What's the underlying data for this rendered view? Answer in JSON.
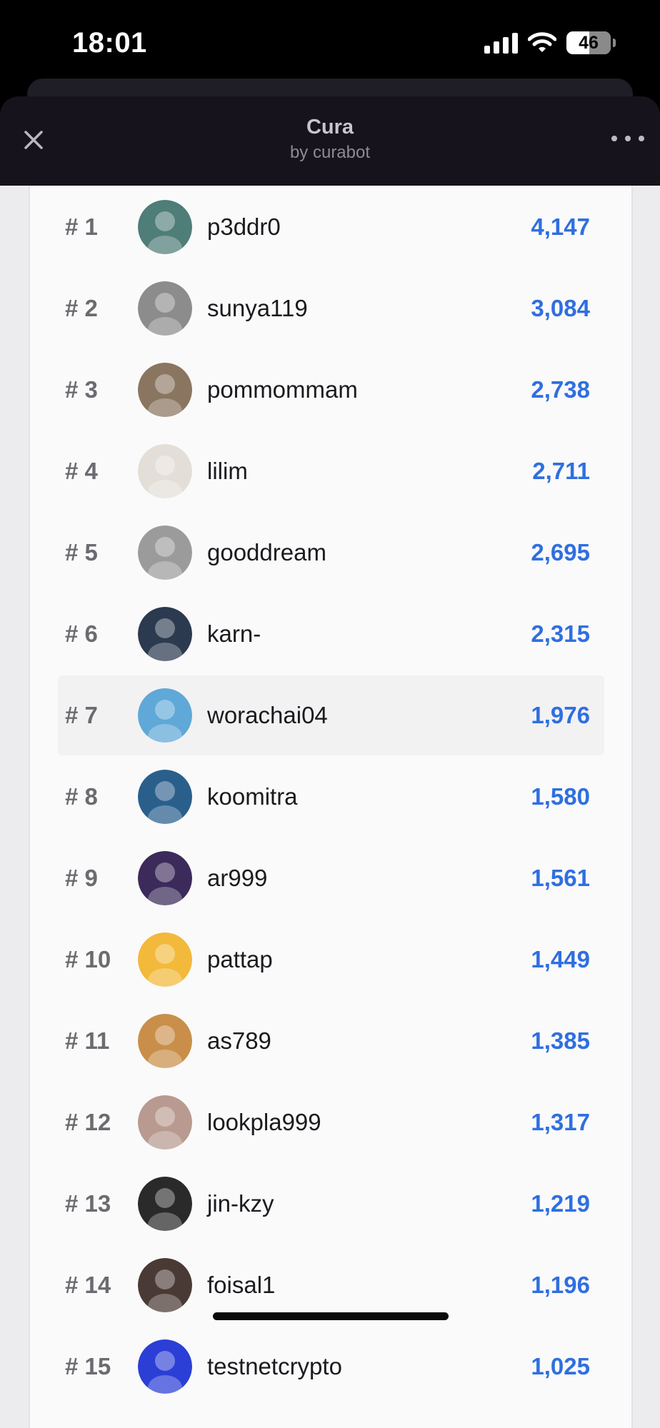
{
  "status_bar": {
    "time": "18:01",
    "battery": "46"
  },
  "header": {
    "title": "Cura",
    "subtitle": "by curabot",
    "close_icon": "close-icon",
    "more_icon": "more-horizontal-icon"
  },
  "leaderboard": [
    {
      "rank": "# 1",
      "username": "p3ddr0",
      "score": "4,147",
      "avatar_color": "#4f7d78"
    },
    {
      "rank": "# 2",
      "username": "sunya119",
      "score": "3,084",
      "avatar_color": "#8c8c8c"
    },
    {
      "rank": "# 3",
      "username": "pommommam",
      "score": "2,738",
      "avatar_color": "#8a7560"
    },
    {
      "rank": "# 4",
      "username": "lilim",
      "score": "2,711",
      "avatar_color": "#e3dfd8"
    },
    {
      "rank": "# 5",
      "username": "gooddream",
      "score": "2,695",
      "avatar_color": "#9b9b9b"
    },
    {
      "rank": "# 6",
      "username": "karn-",
      "score": "2,315",
      "avatar_color": "#2b3a4f"
    },
    {
      "rank": "# 7",
      "username": "worachai04",
      "score": "1,976",
      "avatar_color": "#5fa8d8"
    },
    {
      "rank": "# 8",
      "username": "koomitra",
      "score": "1,580",
      "avatar_color": "#2a5f8c"
    },
    {
      "rank": "# 9",
      "username": "ar999",
      "score": "1,561",
      "avatar_color": "#3b2a5a"
    },
    {
      "rank": "# 10",
      "username": "pattap",
      "score": "1,449",
      "avatar_color": "#f2b93a"
    },
    {
      "rank": "# 11",
      "username": "as789",
      "score": "1,385",
      "avatar_color": "#c98f4a"
    },
    {
      "rank": "# 12",
      "username": "lookpla999",
      "score": "1,317",
      "avatar_color": "#b89a90"
    },
    {
      "rank": "# 13",
      "username": "jin-kzy",
      "score": "1,219",
      "avatar_color": "#2a2a2a"
    },
    {
      "rank": "# 14",
      "username": "foisal1",
      "score": "1,196",
      "avatar_color": "#4a3a35"
    },
    {
      "rank": "# 15",
      "username": "testnetcrypto",
      "score": "1,025",
      "avatar_color": "#2b3fd6"
    }
  ],
  "highlighted_rank": "# 7",
  "colors": {
    "score": "#2f6fe0",
    "rank": "#6b6b70",
    "header_bg": "#16131c"
  }
}
